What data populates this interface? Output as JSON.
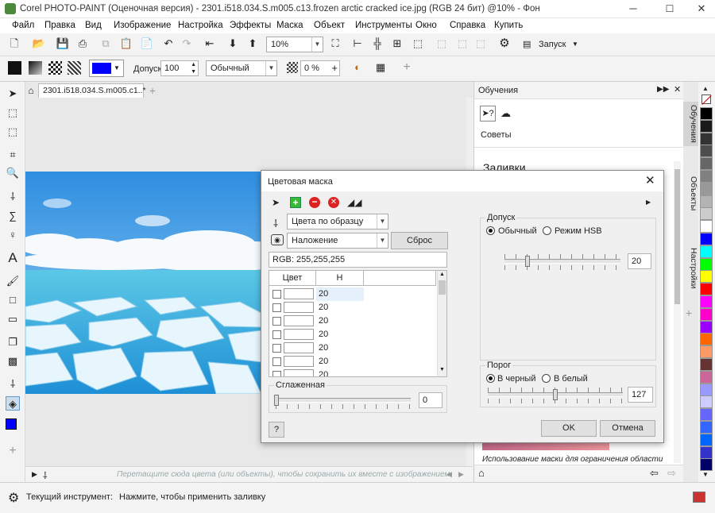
{
  "window": {
    "title": "Corel PHOTO-PAINT (Оценочная версия) - 2301.i518.034.S.m005.c13.frozen arctic cracked ice.jpg (RGB 24 бит) @10% - Фон",
    "min": "─",
    "max": "☐",
    "close": "✕"
  },
  "menu": [
    "Файл",
    "Правка",
    "Вид",
    "Изображение",
    "Настройка",
    "Эффекты",
    "Маска",
    "Объект",
    "Инструменты",
    "Окно",
    "Справка",
    "Купить"
  ],
  "toolbar": {
    "zoom": "10%",
    "launch_label": "Запуск"
  },
  "propbar": {
    "tolerance_label": "Допуск:",
    "tolerance_value": "100",
    "mode_value": "Обычный",
    "transparency_value": "0 %",
    "fill_color": "#0000ff"
  },
  "document": {
    "tab_label": "2301.i518.034.S.m005.c1..*",
    "drop_hint": "Перетащите сюда цвета (или объекты), чтобы сохранить их вместе с изображением"
  },
  "status": {
    "tool_label": "Текущий инструмент:",
    "message": "Нажмите, чтобы применить заливку"
  },
  "right_panel": {
    "title": "Обучения",
    "tips_label": "Советы",
    "heading": "Заливки",
    "footer_text": "Использование маски для ограничения области",
    "tabs": [
      "Обучения",
      "Объекты",
      "Настройки"
    ]
  },
  "palette": [
    "#000000",
    "#1a1a1a",
    "#333333",
    "#4d4d4d",
    "#666666",
    "#808080",
    "#999999",
    "#b3b3b3",
    "#cccccc",
    "#ffffff",
    "#0000ff",
    "#00ffff",
    "#00ff00",
    "#ffff00",
    "#ff0000",
    "#ff00ff",
    "#ff00cc",
    "#9900ff",
    "#ff6600",
    "#ff9966",
    "#663333",
    "#cc6699",
    "#9999ff",
    "#ccccff",
    "#6666ff",
    "#3366ff",
    "#0066ff",
    "#3333cc",
    "#000066"
  ],
  "dialog": {
    "title": "Цветовая маска",
    "method_value": "Цвета по образцу",
    "blend_value": "Наложение",
    "reset_label": "Сброс",
    "rgb_label": "RGB: 255,255,255",
    "col_color": "Цвет",
    "col_h": "H",
    "rows": [
      {
        "h": "20"
      },
      {
        "h": "20"
      },
      {
        "h": "20"
      },
      {
        "h": "20"
      },
      {
        "h": "20"
      },
      {
        "h": "20"
      },
      {
        "h": "20"
      }
    ],
    "smooth_label": "Сглаженная",
    "smooth_value": "0",
    "tolerance": {
      "label": "Допуск",
      "normal": "Обычный",
      "hsb": "Режим HSB",
      "value": "20",
      "level": 0.2
    },
    "threshold": {
      "label": "Порог",
      "to_black": "В черный",
      "to_white": "В белый",
      "value": "127",
      "level": 0.5
    },
    "help_label": "?",
    "ok_label": "OK",
    "cancel_label": "Отмена"
  }
}
